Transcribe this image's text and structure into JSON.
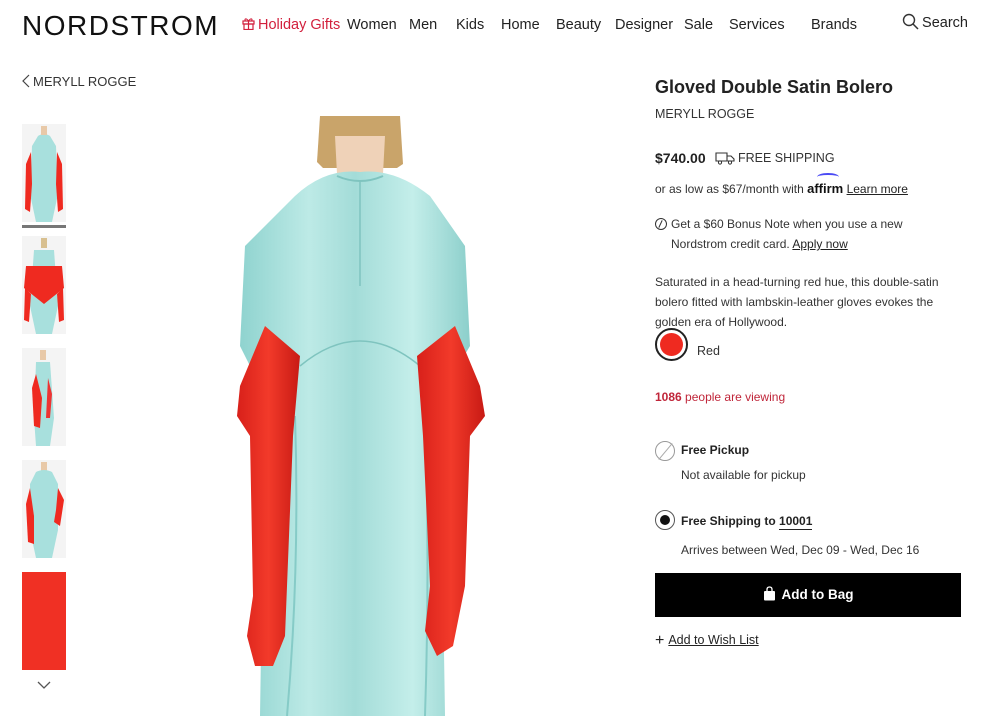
{
  "header": {
    "logo": "NORDSTROM",
    "nav": [
      "Holiday Gifts",
      "Women",
      "Men",
      "Kids",
      "Home",
      "Beauty",
      "Designer",
      "Sale",
      "Services",
      "Brands"
    ],
    "search_label": "Search"
  },
  "breadcrumb": {
    "label": "MERYLL ROGGE"
  },
  "colors": {
    "accent_red": "#d21f3c",
    "swatch_red": "#ef2a20",
    "dress_mint": "#a8e0dd"
  },
  "product": {
    "title": "Gloved Double Satin Bolero",
    "brand": "MERYLL ROGGE",
    "price": "$740.00",
    "shipping_label": "FREE SHIPPING",
    "affirm_prefix": "or as low as $67/month with",
    "affirm_logo": "affirm",
    "learn_more": "Learn more",
    "bonus_line1": "Get a $60 Bonus Note when you use a new",
    "bonus_line2_prefix": "Nordstrom credit card.",
    "apply_now": "Apply now",
    "description": "Saturated in a head-turning red hue, this double-satin bolero fitted with lambskin-leather gloves evokes the golden era of Hollywood.",
    "color_name": "Red",
    "viewing_count": "1086",
    "viewing_suffix": "people are viewing",
    "pickup_title": "Free Pickup",
    "pickup_sub": "Not available for pickup",
    "ship_title_prefix": "Free Shipping to",
    "ship_zip": "10001",
    "ship_sub": "Arrives between Wed, Dec 09 - Wed, Dec 16",
    "add_to_bag": "Add to Bag",
    "wishlist": "Add to Wish List"
  }
}
